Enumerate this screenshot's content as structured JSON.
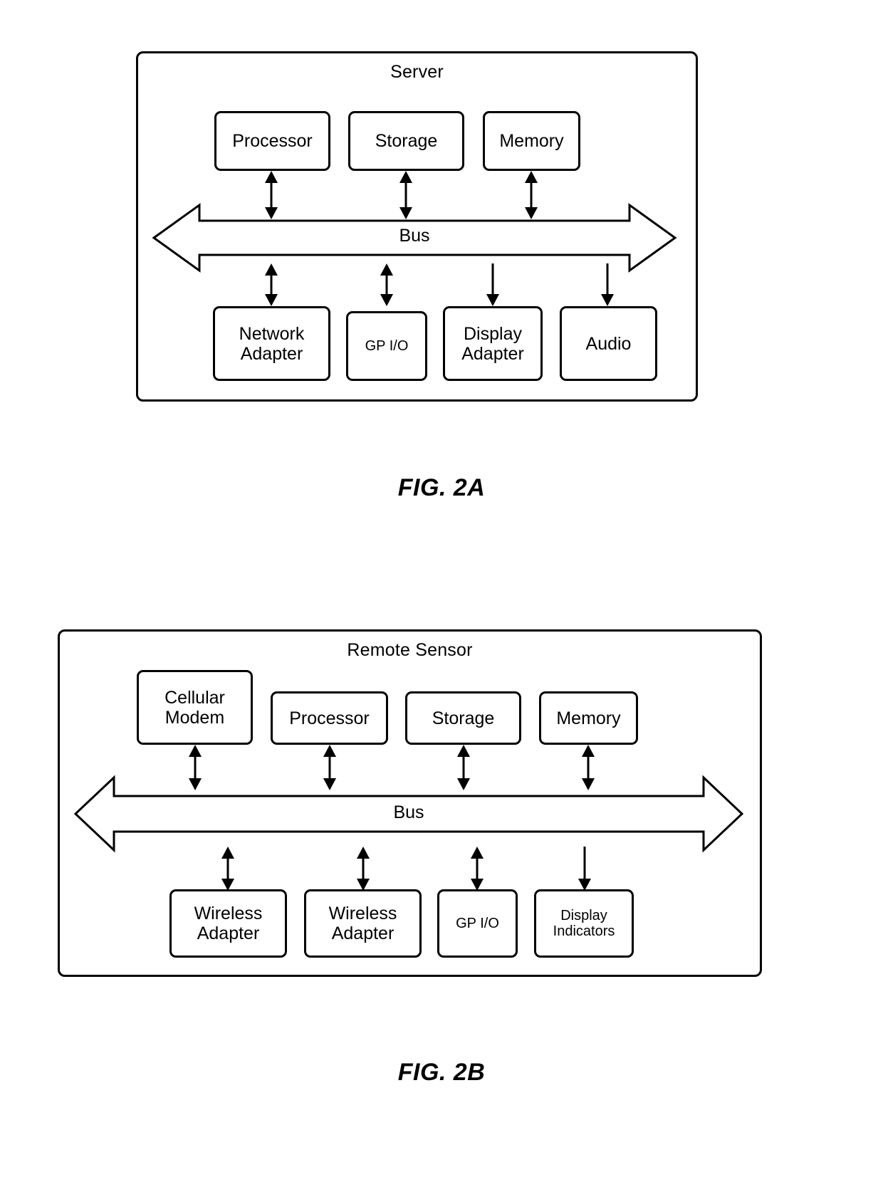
{
  "document": {
    "type": "patent-figure-sheet",
    "figures": [
      {
        "id": "fig-2a",
        "caption": "FIG. 2A",
        "enclosure_title": "Server",
        "bus_label": "Bus",
        "top_components": [
          {
            "label": "Processor",
            "arrow": "bidirectional"
          },
          {
            "label": "Storage",
            "arrow": "bidirectional"
          },
          {
            "label": "Memory",
            "arrow": "bidirectional"
          }
        ],
        "bottom_components": [
          {
            "label": "Network\nAdapter",
            "line1": "Network",
            "line2": "Adapter",
            "arrow": "bidirectional"
          },
          {
            "label": "GP I/O",
            "line1": "GP I/O",
            "line2": "",
            "arrow": "bidirectional"
          },
          {
            "label": "Display\nAdapter",
            "line1": "Display",
            "line2": "Adapter",
            "arrow": "down"
          },
          {
            "label": "Audio",
            "line1": "Audio",
            "line2": "",
            "arrow": "down"
          }
        ]
      },
      {
        "id": "fig-2b",
        "caption": "FIG. 2B",
        "enclosure_title": "Remote Sensor",
        "bus_label": "Bus",
        "top_components": [
          {
            "label": "Cellular\nModem",
            "line1": "Cellular",
            "line2": "Modem",
            "arrow": "bidirectional"
          },
          {
            "label": "Processor",
            "line1": "Processor",
            "line2": "",
            "arrow": "bidirectional"
          },
          {
            "label": "Storage",
            "line1": "Storage",
            "line2": "",
            "arrow": "bidirectional"
          },
          {
            "label": "Memory",
            "line1": "Memory",
            "line2": "",
            "arrow": "bidirectional"
          }
        ],
        "bottom_components": [
          {
            "label": "Wireless\nAdapter",
            "line1": "Wireless",
            "line2": "Adapter",
            "arrow": "bidirectional"
          },
          {
            "label": "Wireless\nAdapter",
            "line1": "Wireless",
            "line2": "Adapter",
            "arrow": "bidirectional"
          },
          {
            "label": "GP I/O",
            "line1": "GP I/O",
            "line2": "",
            "arrow": "bidirectional"
          },
          {
            "label": "Display\nIndicators",
            "line1": "Display",
            "line2": "Indicators",
            "arrow": "down"
          }
        ]
      }
    ]
  },
  "fig2a": {
    "caption": "FIG. 2A",
    "title": "Server",
    "bus_label": "Bus",
    "processor": "Processor",
    "storage": "Storage",
    "memory": "Memory",
    "network_adapter_l1": "Network",
    "network_adapter_l2": "Adapter",
    "gp_io": "GP I/O",
    "display_adapter_l1": "Display",
    "display_adapter_l2": "Adapter",
    "audio": "Audio"
  },
  "fig2b": {
    "caption": "FIG. 2B",
    "title": "Remote Sensor",
    "bus_label": "Bus",
    "cellular_modem_l1": "Cellular",
    "cellular_modem_l2": "Modem",
    "processor": "Processor",
    "storage": "Storage",
    "memory": "Memory",
    "wireless_adapter_1_l1": "Wireless",
    "wireless_adapter_1_l2": "Adapter",
    "wireless_adapter_2_l1": "Wireless",
    "wireless_adapter_2_l2": "Adapter",
    "gp_io": "GP I/O",
    "display_indicators_l1": "Display",
    "display_indicators_l2": "Indicators"
  },
  "style": {
    "stroke_color": "#000000",
    "background_color": "#ffffff",
    "stroke_width_px": 3
  }
}
